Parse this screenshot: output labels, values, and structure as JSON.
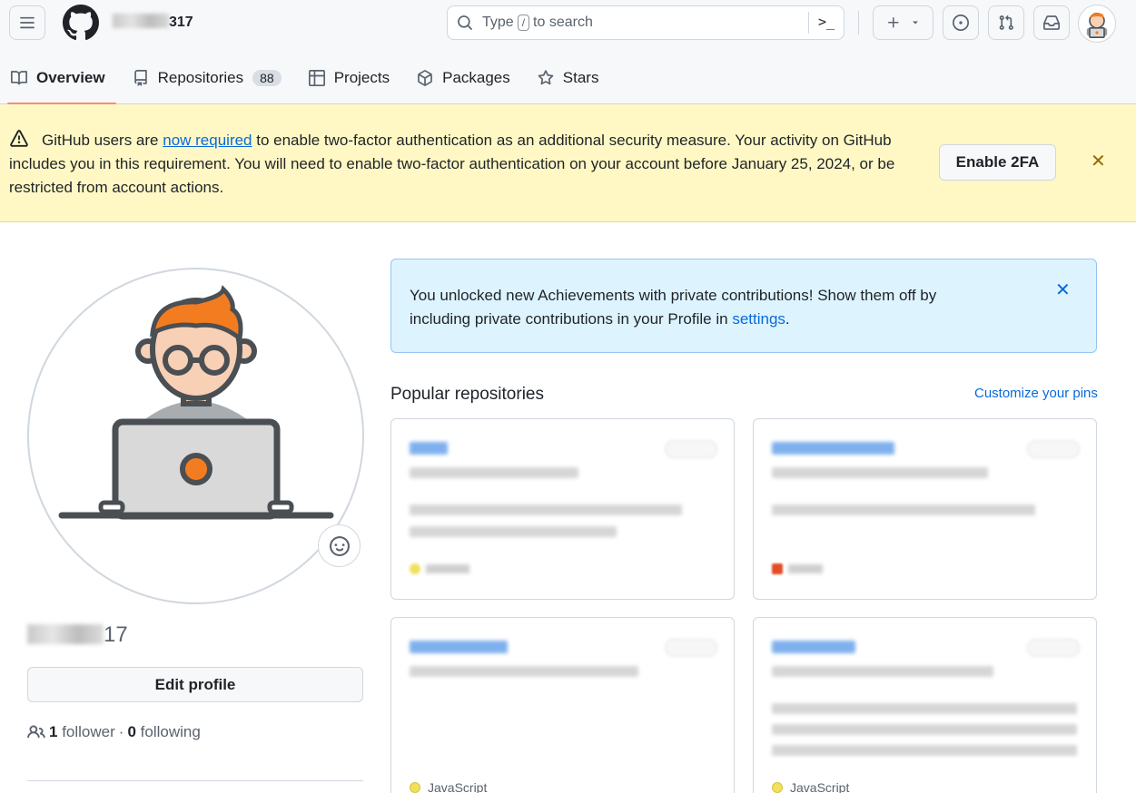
{
  "header": {
    "username_suffix": "317",
    "search": {
      "prefix": "Type",
      "key": "/",
      "suffix": "to search",
      "command_icon": ">_"
    }
  },
  "tabs": [
    {
      "label": "Overview",
      "icon": "book-icon"
    },
    {
      "label": "Repositories",
      "icon": "repo-icon",
      "count": "88"
    },
    {
      "label": "Projects",
      "icon": "table-icon"
    },
    {
      "label": "Packages",
      "icon": "package-icon"
    },
    {
      "label": "Stars",
      "icon": "star-icon"
    }
  ],
  "banner": {
    "text_before": "GitHub users are ",
    "link": "now required",
    "text_after": " to enable two-factor authentication as an additional security measure. Your activity on GitHub includes you in this requirement. You will need to enable two-factor authentication on your account before January 25, 2024, or be restricted from account actions.",
    "button": "Enable 2FA",
    "close": "✕"
  },
  "profile": {
    "name_suffix": "17",
    "edit_button": "Edit profile",
    "followers_count": "1",
    "followers_label": "follower",
    "separator": "·",
    "following_count": "0",
    "following_label": "following"
  },
  "achievements": {
    "text": "You unlocked new Achievements with private contributions! Show them off by including private contributions in your Profile in ",
    "link": "settings",
    "end": ".",
    "close": "✕"
  },
  "popular": {
    "title": "Popular repositories",
    "customize": "Customize your pins"
  },
  "repos": [
    {
      "language": "",
      "color": "#f1e05a"
    },
    {
      "language": "",
      "color": "#e34c26"
    },
    {
      "language": "JavaScript",
      "color": "#f1e05a"
    },
    {
      "language": "JavaScript",
      "color": "#f1e05a"
    }
  ]
}
